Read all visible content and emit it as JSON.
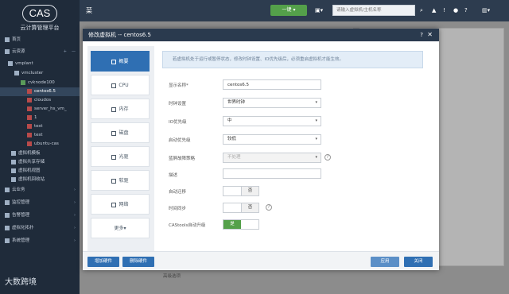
{
  "app": {
    "logo": "CAS",
    "subtitle": "云计算管理平台",
    "brand": "大数跨境"
  },
  "topbar": {
    "menu_icon": "菜",
    "onekey": "一键 ▾",
    "search_placeholder": "请输入虚拟机/主机名称"
  },
  "nav": {
    "home": "首页",
    "cloud_resources": "云资源",
    "tree": [
      "vmplant",
      "vmcluster",
      "cvknode100",
      "centos6.5",
      "cloudos",
      "server_hs_vm_",
      "1",
      "test",
      "test",
      "ubuntu-cas"
    ],
    "items": [
      "虚拟机模板",
      "虚拟共享存储",
      "虚拟机视图",
      "虚拟机回收站"
    ],
    "sections": [
      "云业务",
      "监控管理",
      "告警管理",
      "虚拟化拓扑",
      "系统管理"
    ]
  },
  "modal": {
    "title": "修改虚拟机 -- centos6.5",
    "help": "?",
    "close": "✕",
    "notice": "若虚拟机处于运行或暂停状态，修改时钟设置、IO优先级后，必须重启虚拟机才能生效。",
    "tabs": [
      "概要",
      "CPU",
      "内存",
      "磁盘",
      "光驱",
      "软驱",
      "网络",
      "更多▾"
    ],
    "form": {
      "display_name_label": "显示名称*",
      "display_name": "centos6.5",
      "clock_label": "时钟设置",
      "clock": "世界时钟",
      "io_label": "IO优先级",
      "io": "中",
      "boot_label": "启动优先级",
      "boot": "较低",
      "bluescreen_label": "蓝屏故障策略",
      "bluescreen": "不处理",
      "desc_label": "描述",
      "desc": "",
      "auto_migrate_label": "自动迁移",
      "auto_migrate": "否",
      "time_sync_label": "时间同步",
      "time_sync": "否",
      "castools_label": "CAStools自动升级",
      "castools": "是"
    },
    "footer": {
      "add_hw": "增加硬件",
      "del_hw": "删除硬件",
      "apply": "应用",
      "close": "关闭"
    }
  },
  "background": {
    "high_options": "高级选项"
  }
}
